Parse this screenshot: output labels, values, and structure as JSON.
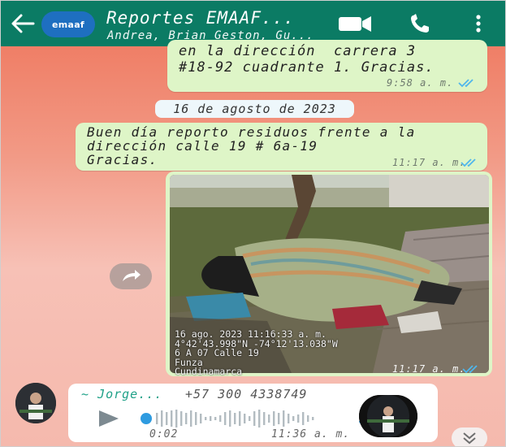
{
  "header": {
    "avatar_text": "emaaf",
    "title": "Reportes EMAAF...",
    "subtitle": "Andrea, Brian Geston, Gu..."
  },
  "messages": {
    "first": {
      "text": "en la dirección  carrera 3\n#18-92 cuadrante 1. Gracias.",
      "time": "9:58 a. m."
    },
    "date_separator": "16 de agosto de 2023",
    "second": {
      "text": "Buen día reporto residuos frente a la\ndirección calle 19 # 6a-19\nGracias.",
      "time": "11:17 a. m."
    },
    "photo": {
      "overlay": "16 ago. 2023 11:16:33 a. m.\n4°42'43.998\"N -74°12'13.038\"W\n6 A 07 Calle 19\nFunza\nCundinamarca",
      "time": "11:17 a. m."
    },
    "audio": {
      "sender": "~ Jorge...",
      "phone": "+57 300 4338749",
      "duration": "0:02",
      "time": "11:36 a. m."
    }
  },
  "icons": {
    "back": "arrow-left-icon",
    "video": "video-camera-icon",
    "call": "phone-icon",
    "menu": "more-vert-icon",
    "forward": "forward-arrow-icon",
    "play": "play-icon",
    "mic": "microphone-icon",
    "scroll": "double-chevron-down-icon",
    "read": "double-check-icon"
  },
  "colors": {
    "header": "#0b7b64",
    "outgoing_bubble": "#def5c7",
    "read_ticks": "#4fb6ec",
    "sender_name": "#1fa188"
  }
}
